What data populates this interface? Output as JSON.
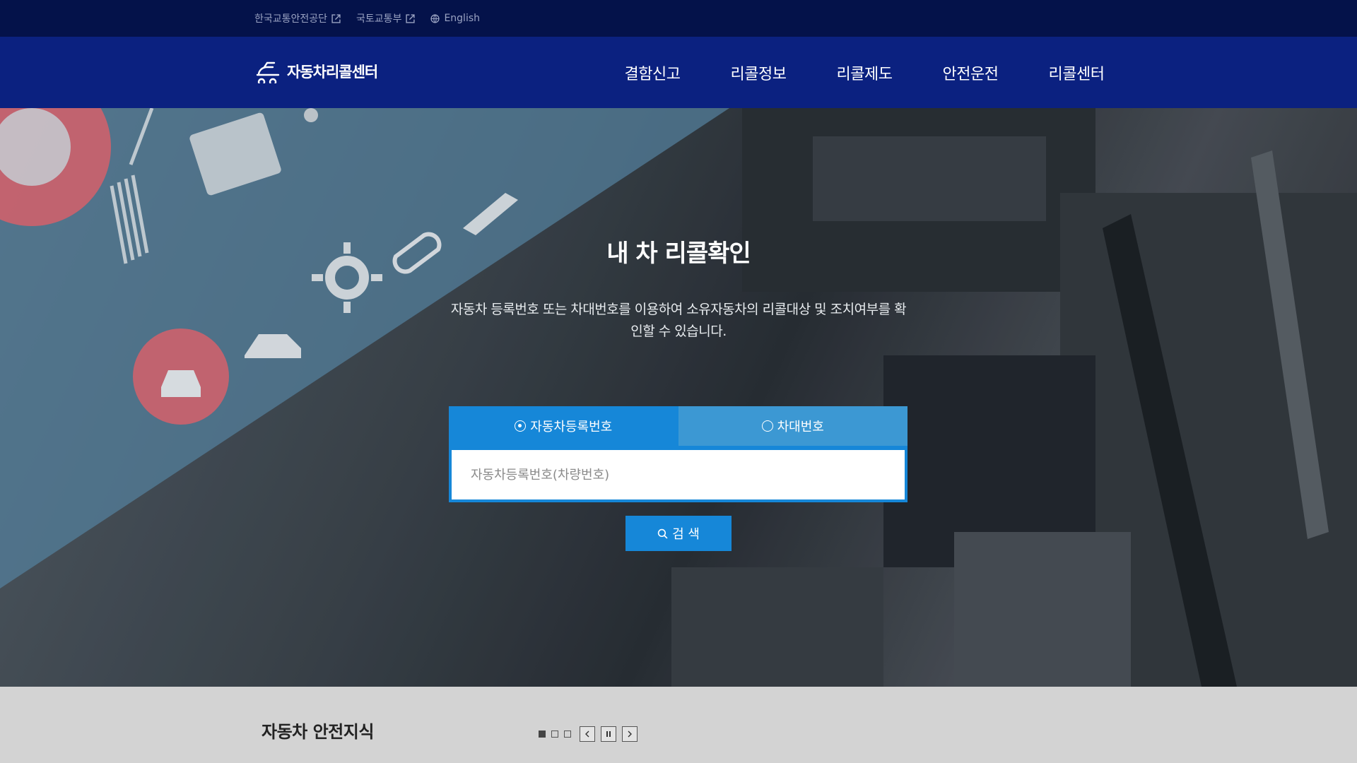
{
  "utility": {
    "links": [
      {
        "label": "한국교통안전공단",
        "icon": "external-link-icon"
      },
      {
        "label": "국토교통부",
        "icon": "external-link-icon"
      },
      {
        "label": "English",
        "icon": "globe-icon"
      }
    ]
  },
  "header": {
    "logo_text": "자동차리콜센터",
    "nav": [
      "결함신고",
      "리콜정보",
      "리콜제도",
      "안전운전",
      "리콜센터"
    ]
  },
  "hero": {
    "title": "내 차 리콜확인",
    "description": "자동차 등록번호 또는 차대번호를 이용하여 소유자동차의 리콜대상 및 조치여부를 확인할 수 있습니다.",
    "tabs": [
      {
        "label": "자동차등록번호",
        "selected": true
      },
      {
        "label": "차대번호",
        "selected": false
      }
    ],
    "search_placeholder": "자동차등록번호(차량번호)",
    "search_button": "검 색"
  },
  "knowledge": {
    "title": "자동차 안전지식",
    "slides_total": 3,
    "slide_active": 1
  },
  "colors": {
    "utility_bg": "#04124a",
    "header_bg": "#0b2180",
    "accent": "#1687d8",
    "tab_inactive": "#3c98d3",
    "footer_bg": "#d3d3d3"
  }
}
